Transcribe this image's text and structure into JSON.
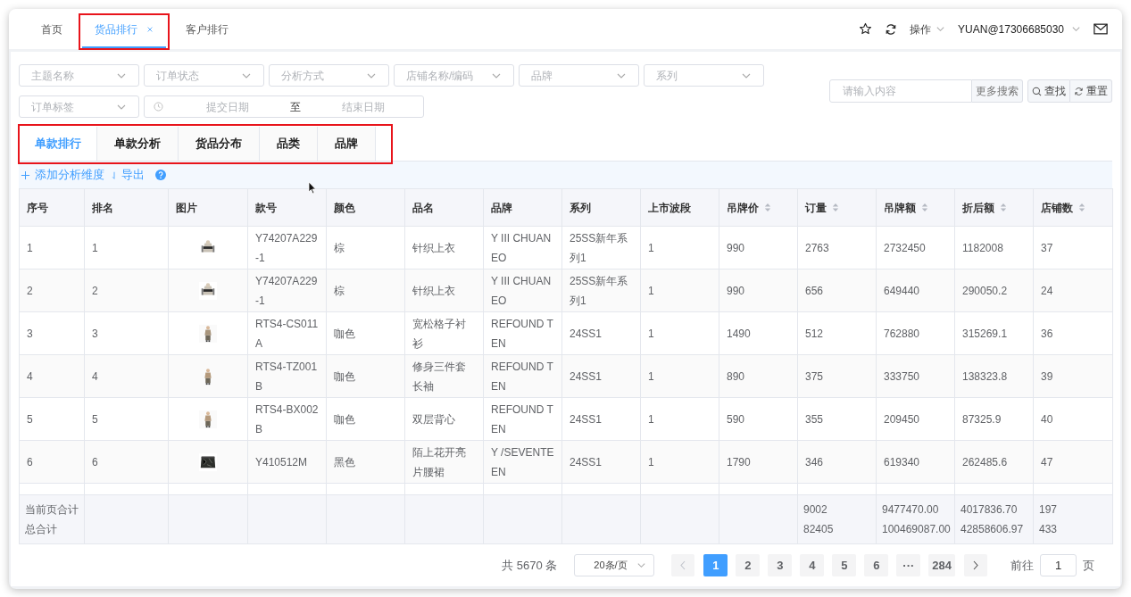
{
  "header": {
    "tabs": [
      {
        "label": "首页",
        "selected": false,
        "closable": false,
        "highlighted": false
      },
      {
        "label": "货品排行",
        "selected": true,
        "closable": true,
        "highlighted": true
      },
      {
        "label": "客户排行",
        "selected": false,
        "closable": false,
        "highlighted": false
      }
    ],
    "actions_menu": "操作",
    "user": "YUAN@17306685030"
  },
  "filters": {
    "selects": [
      {
        "placeholder": "主题名称"
      },
      {
        "placeholder": "订单状态"
      },
      {
        "placeholder": "分析方式"
      },
      {
        "placeholder": "店铺名称/编码"
      },
      {
        "placeholder": "品牌"
      },
      {
        "placeholder": "系列"
      },
      {
        "placeholder": "订单标签"
      }
    ],
    "date_range": {
      "start_placeholder": "提交日期",
      "separator": "至",
      "end_placeholder": "结束日期"
    },
    "search": {
      "placeholder": "请输入内容",
      "addon": "更多搜索"
    },
    "buttons": [
      {
        "kind": "search",
        "label": "查找"
      },
      {
        "kind": "reset",
        "label": "重置"
      }
    ]
  },
  "sub_tabs": {
    "highlighted": true,
    "items": [
      {
        "label": "单款排行",
        "selected": true
      },
      {
        "label": "单款分析",
        "selected": false
      },
      {
        "label": "货品分布",
        "selected": false
      },
      {
        "label": "品类",
        "selected": false
      },
      {
        "label": "品牌",
        "selected": false
      }
    ]
  },
  "toolbar": {
    "actions": [
      {
        "kind": "add",
        "label": "添加分析维度"
      },
      {
        "kind": "export",
        "label": "导出"
      }
    ],
    "help": true
  },
  "table": {
    "columns": [
      {
        "label": "序号",
        "sortable": false
      },
      {
        "label": "排名",
        "sortable": false
      },
      {
        "label": "图片",
        "sortable": false
      },
      {
        "label": "款号",
        "sortable": false
      },
      {
        "label": "颜色",
        "sortable": false
      },
      {
        "label": "品名",
        "sortable": false
      },
      {
        "label": "品牌",
        "sortable": false
      },
      {
        "label": "系列",
        "sortable": false
      },
      {
        "label": "上市波段",
        "sortable": false
      },
      {
        "label": "吊牌价",
        "sortable": true
      },
      {
        "label": "订量",
        "sortable": true
      },
      {
        "label": "吊牌额",
        "sortable": true
      },
      {
        "label": "折后额",
        "sortable": true
      },
      {
        "label": "店铺数",
        "sortable": true
      }
    ],
    "rows": [
      {
        "cells": [
          {
            "kind": "text",
            "text": "1"
          },
          {
            "kind": "text",
            "text": "1"
          },
          {
            "kind": "picture"
          },
          {
            "kind": "text",
            "text": "Y74207A229-1"
          },
          {
            "kind": "text",
            "text": "棕"
          },
          {
            "kind": "text",
            "text": "针织上衣"
          },
          {
            "kind": "text",
            "text": "Y III CHUAN EO"
          },
          {
            "kind": "text",
            "text": "25SS新年系列1"
          },
          {
            "kind": "text",
            "text": "1"
          },
          {
            "kind": "text",
            "text": "990"
          },
          {
            "kind": "text",
            "text": "2763"
          },
          {
            "kind": "text",
            "text": "2732450"
          },
          {
            "kind": "text",
            "text": "1182008"
          },
          {
            "kind": "text",
            "text": "37"
          }
        ]
      },
      {
        "cells": [
          {
            "kind": "text",
            "text": "2"
          },
          {
            "kind": "text",
            "text": "2"
          },
          {
            "kind": "picture"
          },
          {
            "kind": "text",
            "text": "Y74207A229-1"
          },
          {
            "kind": "text",
            "text": "棕"
          },
          {
            "kind": "text",
            "text": "针织上衣"
          },
          {
            "kind": "text",
            "text": "Y III CHUAN EO"
          },
          {
            "kind": "text",
            "text": "25SS新年系列1"
          },
          {
            "kind": "text",
            "text": "1"
          },
          {
            "kind": "text",
            "text": "990"
          },
          {
            "kind": "text",
            "text": "656"
          },
          {
            "kind": "text",
            "text": "649440"
          },
          {
            "kind": "text",
            "text": "290050.2"
          },
          {
            "kind": "text",
            "text": "24"
          }
        ]
      },
      {
        "cells": [
          {
            "kind": "text",
            "text": "3"
          },
          {
            "kind": "text",
            "text": "3"
          },
          {
            "kind": "picture"
          },
          {
            "kind": "text",
            "text": "RTS4-CS011A"
          },
          {
            "kind": "text",
            "text": "咖色"
          },
          {
            "kind": "text",
            "text": "宽松格子衬衫"
          },
          {
            "kind": "text",
            "text": "REFOUND TEN"
          },
          {
            "kind": "text",
            "text": "24SS1"
          },
          {
            "kind": "text",
            "text": "1"
          },
          {
            "kind": "text",
            "text": "1490"
          },
          {
            "kind": "text",
            "text": "512"
          },
          {
            "kind": "text",
            "text": "762880"
          },
          {
            "kind": "text",
            "text": "315269.1"
          },
          {
            "kind": "text",
            "text": "36"
          }
        ]
      },
      {
        "cells": [
          {
            "kind": "text",
            "text": "4"
          },
          {
            "kind": "text",
            "text": "4"
          },
          {
            "kind": "picture"
          },
          {
            "kind": "text",
            "text": "RTS4-TZ001B"
          },
          {
            "kind": "text",
            "text": "咖色"
          },
          {
            "kind": "text",
            "text": "修身三件套长袖"
          },
          {
            "kind": "text",
            "text": "REFOUND TEN"
          },
          {
            "kind": "text",
            "text": "24SS1"
          },
          {
            "kind": "text",
            "text": "1"
          },
          {
            "kind": "text",
            "text": "890"
          },
          {
            "kind": "text",
            "text": "375"
          },
          {
            "kind": "text",
            "text": "333750"
          },
          {
            "kind": "text",
            "text": "138323.8"
          },
          {
            "kind": "text",
            "text": "39"
          }
        ]
      },
      {
        "cells": [
          {
            "kind": "text",
            "text": "5"
          },
          {
            "kind": "text",
            "text": "5"
          },
          {
            "kind": "picture"
          },
          {
            "kind": "text",
            "text": "RTS4-BX002B"
          },
          {
            "kind": "text",
            "text": "咖色"
          },
          {
            "kind": "text",
            "text": "双层背心"
          },
          {
            "kind": "text",
            "text": "REFOUND TEN"
          },
          {
            "kind": "text",
            "text": "24SS1"
          },
          {
            "kind": "text",
            "text": "1"
          },
          {
            "kind": "text",
            "text": "590"
          },
          {
            "kind": "text",
            "text": "355"
          },
          {
            "kind": "text",
            "text": "209450"
          },
          {
            "kind": "text",
            "text": "87325.9"
          },
          {
            "kind": "text",
            "text": "40"
          }
        ]
      },
      {
        "cells": [
          {
            "kind": "text",
            "text": "6"
          },
          {
            "kind": "text",
            "text": "6"
          },
          {
            "kind": "picture"
          },
          {
            "kind": "text",
            "text": "Y410512M"
          },
          {
            "kind": "text",
            "text": "黑色"
          },
          {
            "kind": "text",
            "text": "陌上花开亮片腰裙"
          },
          {
            "kind": "text",
            "text": "Y /SEVENTEEN"
          },
          {
            "kind": "text",
            "text": "24SS1"
          },
          {
            "kind": "text",
            "text": "1"
          },
          {
            "kind": "text",
            "text": "1790"
          },
          {
            "kind": "text",
            "text": "346"
          },
          {
            "kind": "text",
            "text": "619340"
          },
          {
            "kind": "text",
            "text": "262485.6"
          },
          {
            "kind": "text",
            "text": "47"
          }
        ]
      }
    ],
    "summary": [
      {
        "cells": [
          {
            "kind": "text",
            "text": "当前页合计"
          },
          {
            "kind": "blank"
          },
          {
            "kind": "blank"
          },
          {
            "kind": "blank"
          },
          {
            "kind": "blank"
          },
          {
            "kind": "blank"
          },
          {
            "kind": "blank"
          },
          {
            "kind": "blank"
          },
          {
            "kind": "blank"
          },
          {
            "kind": "blank"
          },
          {
            "kind": "text",
            "text": "9002"
          },
          {
            "kind": "text",
            "text": "9477470.00"
          },
          {
            "kind": "text",
            "text": "4017836.70"
          },
          {
            "kind": "text",
            "text": "197"
          }
        ]
      },
      {
        "cells": [
          {
            "kind": "text",
            "text": "总合计"
          },
          {
            "kind": "blank"
          },
          {
            "kind": "blank"
          },
          {
            "kind": "blank"
          },
          {
            "kind": "blank"
          },
          {
            "kind": "blank"
          },
          {
            "kind": "blank"
          },
          {
            "kind": "blank"
          },
          {
            "kind": "blank"
          },
          {
            "kind": "blank"
          },
          {
            "kind": "text",
            "text": "82405"
          },
          {
            "kind": "text",
            "text": "100469087.00"
          },
          {
            "kind": "text",
            "text": "42858606.97"
          },
          {
            "kind": "text",
            "text": "433"
          }
        ]
      }
    ]
  },
  "pagination": {
    "total": "共 5670 条",
    "page_size": "20条/页",
    "pages": [
      {
        "label": "1",
        "selected": true
      },
      {
        "label": "2",
        "selected": false
      },
      {
        "label": "3",
        "selected": false
      },
      {
        "label": "4",
        "selected": false
      },
      {
        "label": "5",
        "selected": false
      },
      {
        "label": "6",
        "selected": false
      },
      {
        "label": "···",
        "selected": false
      },
      {
        "label": "284",
        "selected": false
      }
    ],
    "jump_label": "前往",
    "jump_value": "1",
    "jump_suffix": "页"
  }
}
